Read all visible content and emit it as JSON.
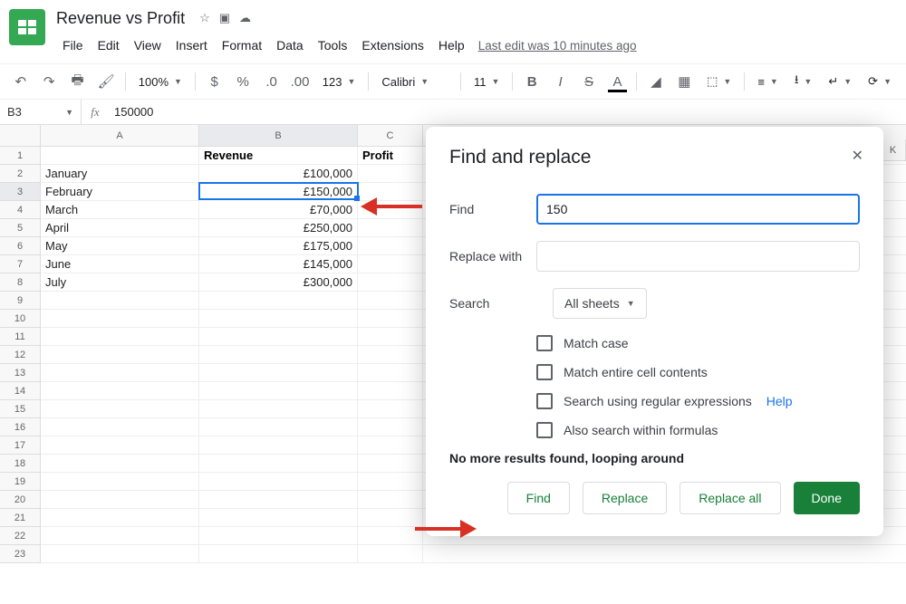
{
  "doc": {
    "title": "Revenue vs Profit"
  },
  "menus": [
    "File",
    "Edit",
    "View",
    "Insert",
    "Format",
    "Data",
    "Tools",
    "Extensions",
    "Help"
  ],
  "last_edit": "Last edit was 10 minutes ago",
  "toolbar": {
    "zoom": "100%",
    "font": "Calibri",
    "font_size": "11"
  },
  "name_box": "B3",
  "formula_value": "150000",
  "col_headers": [
    "A",
    "B",
    "C"
  ],
  "far_col": "K",
  "rows": [
    {
      "n": "1",
      "a": "",
      "b": "Revenue",
      "c": "Profit",
      "bold": true,
      "ba": "left"
    },
    {
      "n": "2",
      "a": "January",
      "b": "£100,000",
      "c": ""
    },
    {
      "n": "3",
      "a": "February",
      "b": "£150,000",
      "c": "",
      "active": true
    },
    {
      "n": "4",
      "a": "March",
      "b": "£70,000",
      "c": ""
    },
    {
      "n": "5",
      "a": "April",
      "b": "£250,000",
      "c": ""
    },
    {
      "n": "6",
      "a": "May",
      "b": "£175,000",
      "c": ""
    },
    {
      "n": "7",
      "a": "June",
      "b": "£145,000",
      "c": ""
    },
    {
      "n": "8",
      "a": "July",
      "b": "£300,000",
      "c": ""
    },
    {
      "n": "9",
      "a": "",
      "b": "",
      "c": ""
    },
    {
      "n": "10",
      "a": "",
      "b": "",
      "c": ""
    },
    {
      "n": "11",
      "a": "",
      "b": "",
      "c": ""
    },
    {
      "n": "12",
      "a": "",
      "b": "",
      "c": ""
    },
    {
      "n": "13",
      "a": "",
      "b": "",
      "c": ""
    },
    {
      "n": "14",
      "a": "",
      "b": "",
      "c": ""
    },
    {
      "n": "15",
      "a": "",
      "b": "",
      "c": ""
    },
    {
      "n": "16",
      "a": "",
      "b": "",
      "c": ""
    },
    {
      "n": "17",
      "a": "",
      "b": "",
      "c": ""
    },
    {
      "n": "18",
      "a": "",
      "b": "",
      "c": ""
    },
    {
      "n": "19",
      "a": "",
      "b": "",
      "c": ""
    },
    {
      "n": "20",
      "a": "",
      "b": "",
      "c": ""
    },
    {
      "n": "21",
      "a": "",
      "b": "",
      "c": ""
    },
    {
      "n": "22",
      "a": "",
      "b": "",
      "c": ""
    },
    {
      "n": "23",
      "a": "",
      "b": "",
      "c": ""
    }
  ],
  "dialog": {
    "title": "Find and replace",
    "find_label": "Find",
    "find_value": "150",
    "replace_label": "Replace with",
    "replace_value": "",
    "search_label": "Search",
    "search_scope": "All sheets",
    "opt_match_case": "Match case",
    "opt_entire": "Match entire cell contents",
    "opt_regex": "Search using regular expressions",
    "help": "Help",
    "opt_formulas": "Also search within formulas",
    "status": "No more results found, looping around",
    "btn_find": "Find",
    "btn_replace": "Replace",
    "btn_replace_all": "Replace all",
    "btn_done": "Done"
  }
}
